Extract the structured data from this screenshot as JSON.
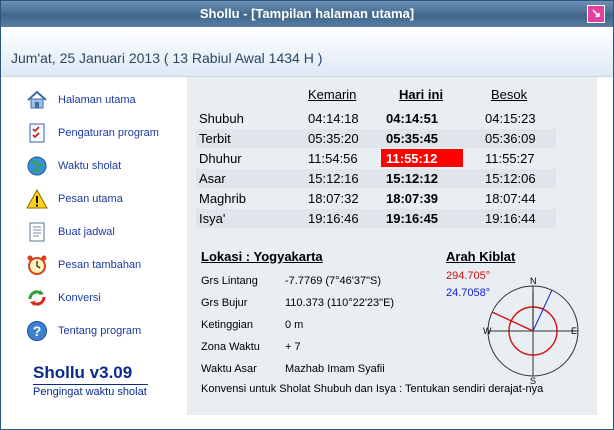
{
  "window": {
    "title": "Shollu - [Tampilan halaman utama]"
  },
  "header": {
    "date": "Jum'at, 25 Januari 2013 ( 13 Rabiul Awal 1434 H )"
  },
  "sidebar": {
    "items": [
      {
        "label": "Halaman utama",
        "icon": "home-icon"
      },
      {
        "label": "Pengaturan program",
        "icon": "checklist-icon"
      },
      {
        "label": "Waktu sholat",
        "icon": "globe-icon"
      },
      {
        "label": "Pesan utama",
        "icon": "warning-icon"
      },
      {
        "label": "Buat jadwal",
        "icon": "document-icon"
      },
      {
        "label": "Pesan tambahan",
        "icon": "alarm-clock-icon"
      },
      {
        "label": "Konversi",
        "icon": "convert-arrows-icon"
      },
      {
        "label": "Tentang program",
        "icon": "help-icon"
      }
    ],
    "brand_title": "Shollu v3.09",
    "brand_subtitle": "Pengingat waktu sholat"
  },
  "schedule": {
    "headers": {
      "yesterday": "Kemarin",
      "today": "Hari ini",
      "tomorrow": "Besok"
    },
    "rows": [
      {
        "name": "Shubuh",
        "yesterday": "04:14:18",
        "today": "04:14:51",
        "tomorrow": "04:15:23"
      },
      {
        "name": "Terbit",
        "yesterday": "05:35:20",
        "today": "05:35:45",
        "tomorrow": "05:36:09"
      },
      {
        "name": "Dhuhur",
        "yesterday": "11:54:56",
        "today": "11:55:12",
        "tomorrow": "11:55:27"
      },
      {
        "name": "Asar",
        "yesterday": "15:12:16",
        "today": "15:12:12",
        "tomorrow": "15:12:06"
      },
      {
        "name": "Maghrib",
        "yesterday": "18:07:32",
        "today": "18:07:39",
        "tomorrow": "18:07:44"
      },
      {
        "name": "Isya'",
        "yesterday": "19:16:46",
        "today": "19:16:45",
        "tomorrow": "19:16:44"
      }
    ],
    "highlight_color": "#ff0000"
  },
  "location": {
    "title": "Lokasi :  Yogyakarta",
    "fields": [
      {
        "label": "Grs Lintang",
        "value": "-7.7769 (7°46'37\"S)"
      },
      {
        "label": "Grs Bujur",
        "value": "110.373 (110°22'23\"E)"
      },
      {
        "label": "Ketinggian",
        "value": "0 m"
      },
      {
        "label": "Zona Waktu",
        "value": "+ 7"
      },
      {
        "label": "Waktu Asar",
        "value": "Mazhab Imam Syafii"
      }
    ],
    "conversion_note": "Konvensi untuk Sholat Shubuh dan Isya : Tentukan sendiri derajat-nya"
  },
  "qibla": {
    "title": "Arah Kiblat",
    "angle_red": "294.705°",
    "angle_blue": "24.7058°",
    "compass": {
      "north": "N",
      "south": "S",
      "east": "E",
      "west": "W"
    }
  }
}
